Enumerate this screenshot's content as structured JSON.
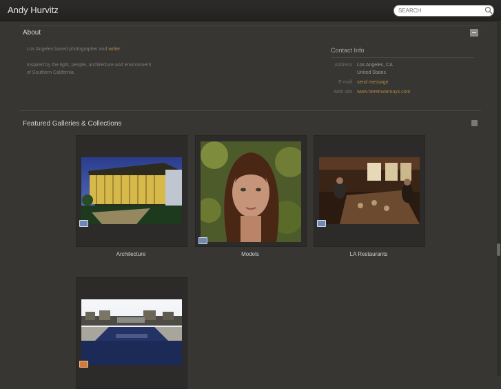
{
  "header": {
    "site_title": "Andy Hurvitz",
    "search_placeholder": "SEARCH"
  },
  "about": {
    "heading": "About",
    "line1_prefix": "Los Angeles based photographer and ",
    "line1_link": "writer",
    "line2a": "Inspired by the light, people, architecture and environment",
    "line2b": "of Southern California."
  },
  "contact": {
    "heading": "Contact Info",
    "address_label": "Address",
    "address_line1": "Los Angeles, CA",
    "address_line2": "United States",
    "email_label": "E-mail",
    "email_value": "send message",
    "website_label": "Web site",
    "website_value": "www.hereinvannuys.com"
  },
  "galleries": {
    "heading": "Featured Galleries & Collections",
    "items": [
      {
        "caption": "Architecture"
      },
      {
        "caption": "Models"
      },
      {
        "caption": "LA Restaurants"
      },
      {
        "caption": ""
      }
    ]
  },
  "colors": {
    "background": "#373633",
    "link": "#b08a41",
    "tile": "#2c2b29"
  }
}
